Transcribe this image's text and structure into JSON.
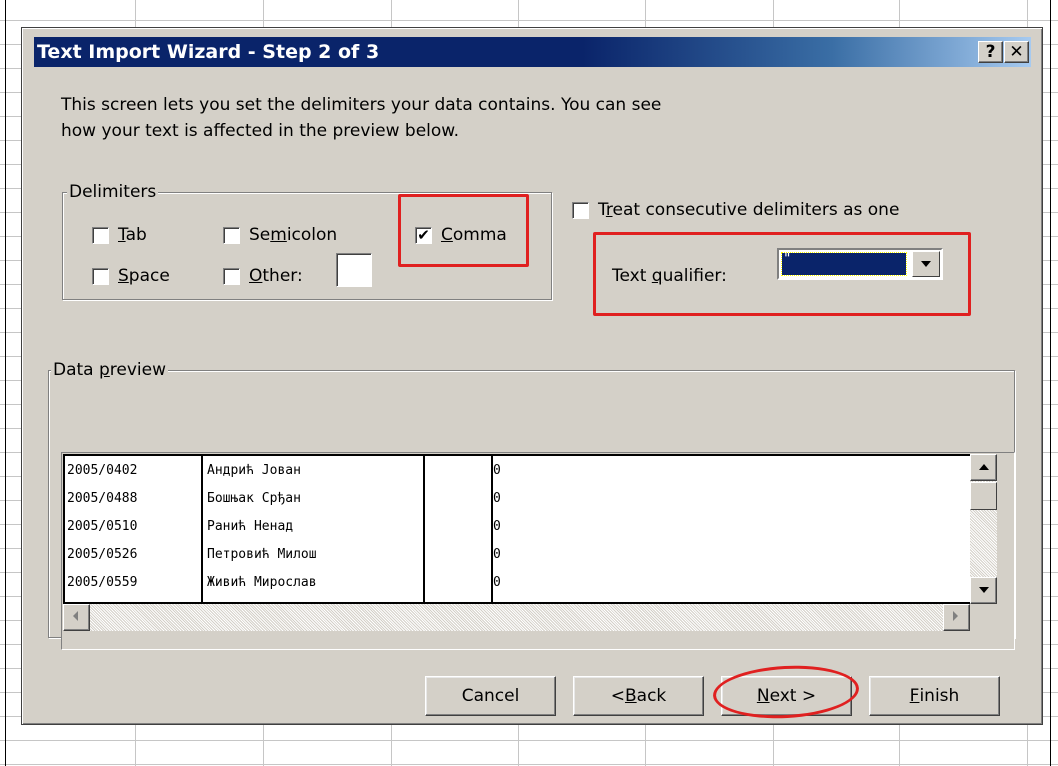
{
  "window": {
    "title": "Text Import Wizard - Step 2 of 3",
    "help_label": "?",
    "close_label": "✕"
  },
  "intro": {
    "line1": "This screen lets you set the delimiters your data contains.  You can see",
    "line2": "how your text is affected in the preview below."
  },
  "delimiters": {
    "legend": "Delimiters",
    "tab": {
      "pre": "",
      "ul": "T",
      "post": "ab",
      "checked": false
    },
    "semicolon": {
      "pre": "Se",
      "ul": "m",
      "post": "icolon",
      "checked": false
    },
    "comma": {
      "pre": "",
      "ul": "C",
      "post": "omma",
      "checked": true,
      "check_glyph": "✔"
    },
    "space": {
      "pre": "",
      "ul": "S",
      "post": "pace",
      "checked": false
    },
    "other": {
      "pre": "",
      "ul": "O",
      "post": "ther:",
      "checked": false,
      "value": ""
    }
  },
  "consecutive": {
    "pre": "T",
    "ul": "r",
    "post": "eat consecutive delimiters as one",
    "checked": false
  },
  "qualifier": {
    "pre": "Text ",
    "ul": "q",
    "post": "ualifier:",
    "selected": "\""
  },
  "preview": {
    "legend_pre": "Data ",
    "legend_ul": "p",
    "legend_post": "review",
    "rows": [
      [
        "2005/0402",
        "Андрић Јован",
        "",
        "0"
      ],
      [
        "2005/0488",
        "Бошњак Срђан",
        "",
        "0"
      ],
      [
        "2005/0510",
        "Ранић Ненад",
        "",
        "0"
      ],
      [
        "2005/0526",
        "Петровић Милош",
        "",
        "0"
      ],
      [
        "2005/0559",
        "Живић Мирослав",
        "",
        "0"
      ]
    ]
  },
  "buttons": {
    "cancel": "Cancel",
    "back": {
      "pre": "< ",
      "ul": "B",
      "post": "ack"
    },
    "next": {
      "pre": "",
      "ul": "N",
      "post": "ext >"
    },
    "finish": {
      "pre": "",
      "ul": "F",
      "post": "inish"
    }
  },
  "colors": {
    "title_bar": "#0a246a",
    "dialog_face": "#d4d0c8",
    "highlight_annotation": "#e02020"
  }
}
